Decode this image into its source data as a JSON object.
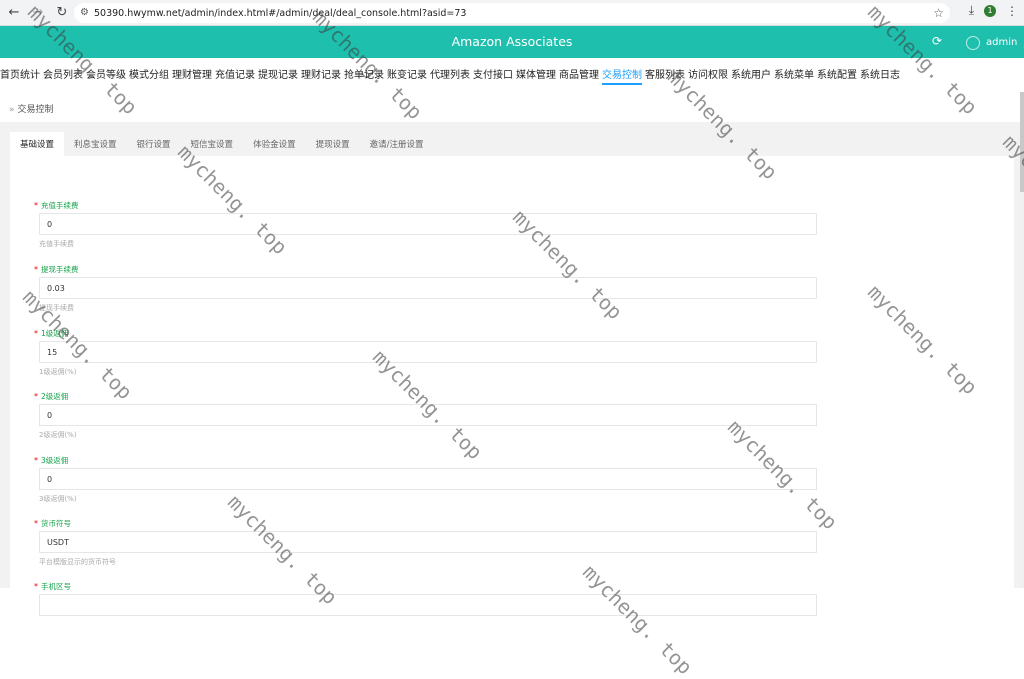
{
  "browser": {
    "url": "50390.hwymw.net/admin/index.html#/admin/deal/deal_console.html?asid=73",
    "profile_initial": "1"
  },
  "header": {
    "title": "Amazon Associates",
    "user": "admin"
  },
  "nav": [
    "首页统计",
    "会员列表",
    "会员等级",
    "模式分组",
    "理财管理",
    "充值记录",
    "提现记录",
    "理财记录",
    "抢单记录",
    "账变记录",
    "代理列表",
    "支付接口",
    "媒体管理",
    "商品管理",
    "交易控制",
    "客服列表",
    "访问权限",
    "系统用户",
    "系统菜单",
    "系统配置",
    "系统日志"
  ],
  "nav_active": "交易控制",
  "breadcrumb": "交易控制",
  "tabs": [
    "基础设置",
    "利息宝设置",
    "银行设置",
    "短信宝设置",
    "体验金设置",
    "提现设置",
    "邀请/注册设置"
  ],
  "tab_active": "基础设置",
  "fields": [
    {
      "label": "充值手续费",
      "value": "0",
      "hint": "充值手续费"
    },
    {
      "label": "提现手续费",
      "value": "0.03",
      "hint": "提现手续费"
    },
    {
      "label": "1级返佣",
      "value": "15",
      "hint": "1级返佣(%)"
    },
    {
      "label": "2级返佣",
      "value": "0",
      "hint": "2级返佣(%)"
    },
    {
      "label": "3级返佣",
      "value": "0",
      "hint": "3级返佣(%)"
    },
    {
      "label": "货币符号",
      "value": "USDT",
      "hint": "平台模版显示的货币符号"
    },
    {
      "label": "手机区号",
      "value": "",
      "hint": ""
    }
  ],
  "watermark": "mycheng. top",
  "colors": {
    "header": "#1fbfad",
    "active": "#1e9fff",
    "label": "#16a34a"
  }
}
